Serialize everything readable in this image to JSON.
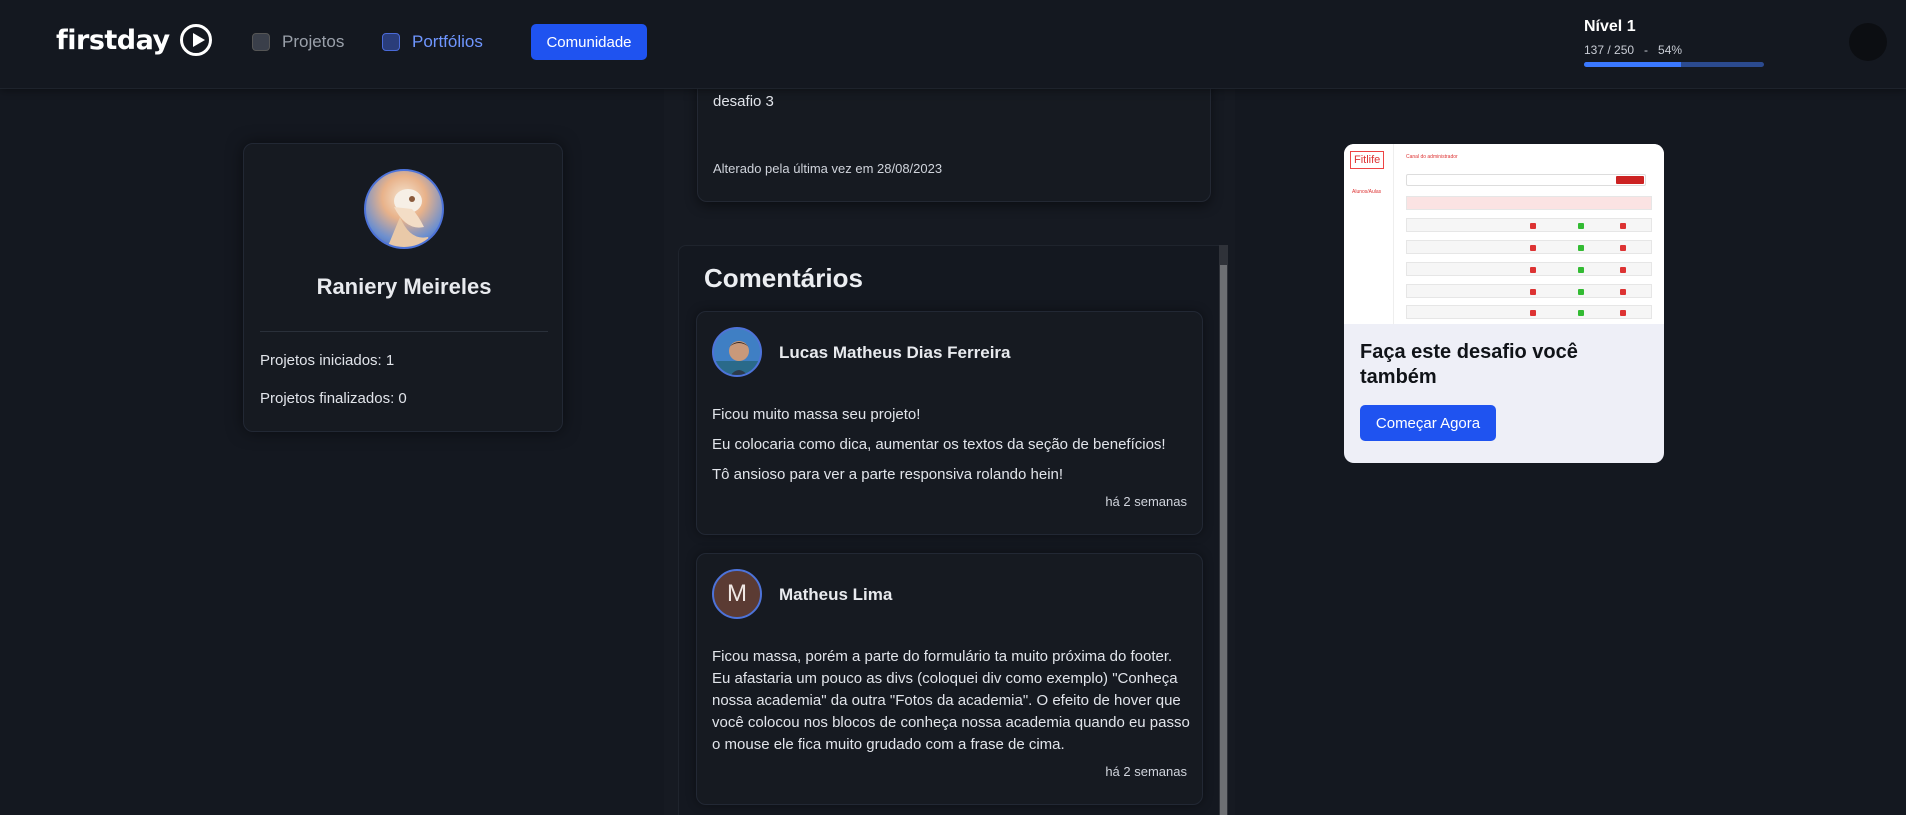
{
  "header": {
    "logo_text": "firstday",
    "nav": {
      "projetos_label": "Projetos",
      "portfolios_label": "Portfólios",
      "comunidade_label": "Comunidade"
    },
    "level": {
      "title": "Nível 1",
      "progress_text": "137 / 250   -   54%",
      "progress_value": 0.54
    }
  },
  "profile": {
    "name": "Raniery Meireles",
    "projetos_iniciados": "Projetos iniciados: 1",
    "projetos_finalizados": "Projetos finalizados: 0"
  },
  "project": {
    "description": "desafio 3",
    "updated": "Alterado pela última vez em 28/08/2023"
  },
  "comments": {
    "title": "Comentários",
    "items": [
      {
        "author": "Lucas Matheus Dias Ferreira",
        "lines": [
          "Ficou muito massa seu projeto!",
          "Eu colocaria como dica, aumentar os textos da seção de benefícios!",
          "Tô ansioso para ver a parte responsiva rolando hein!"
        ],
        "time": "há 2 semanas"
      },
      {
        "author": "Matheus Lima",
        "avatar_initial": "M",
        "text": "Ficou massa, porém a parte do formulário ta muito próxima do footer. Eu afastaria um pouco as divs (coloquei div como exemplo) \"Conheça nossa academia\" da outra \"Fotos da academia\". O efeito de hover que você colocou nos blocos de conheça nossa academia quando eu passo o mouse ele fica muito grudado com a frase de cima.",
        "time": "há 2 semanas"
      }
    ]
  },
  "promo": {
    "screenshot": {
      "logo": "Fitlife",
      "panel_title": "Canal do administrador",
      "side_item": "Alunos/Aulas"
    },
    "title": "Faça este desafio você também",
    "button_label": "Começar Agora"
  },
  "colors": {
    "background": "#141820",
    "accent": "#1f53f0",
    "link_active": "#6f96ff",
    "card": "#161a21"
  }
}
